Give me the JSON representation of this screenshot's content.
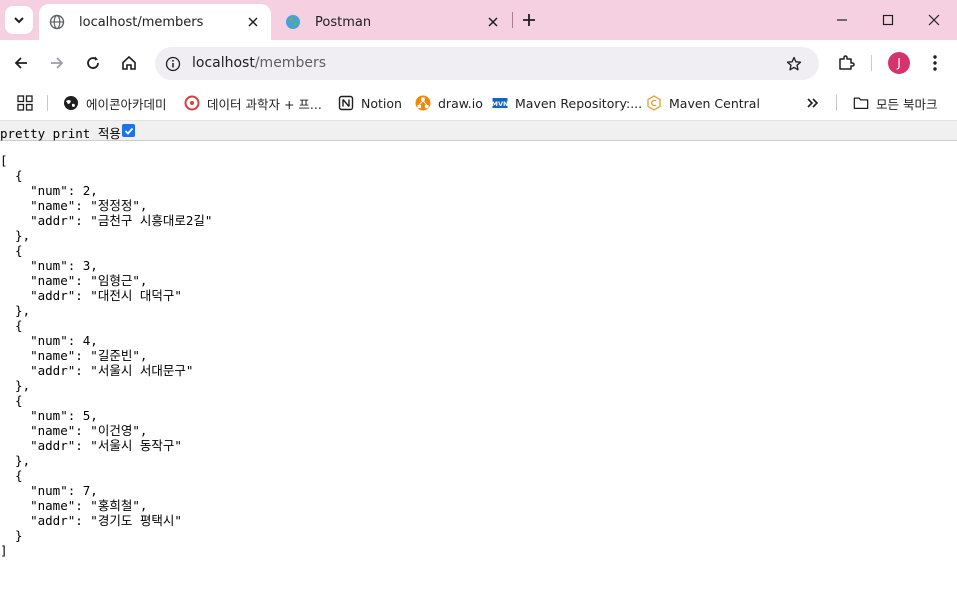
{
  "browser": {
    "tabs": [
      {
        "title": "localhost/members",
        "active": true,
        "favicon": "globe-icon"
      },
      {
        "title": "Postman",
        "active": false,
        "favicon": "earth-icon"
      }
    ],
    "address": {
      "host": "localhost",
      "path": "/members"
    },
    "profile_initial": "J"
  },
  "bookmarks": {
    "items": [
      {
        "label": "에이콘아카데미",
        "icon": "globe-icon"
      },
      {
        "label": "데이터 과학자 + 프...",
        "icon": "red-circle-icon"
      },
      {
        "label": "Notion",
        "icon": "notion-icon"
      },
      {
        "label": "draw.io",
        "icon": "drawio-icon"
      },
      {
        "label": "Maven Repository:...",
        "icon": "mvn-icon"
      },
      {
        "label": "Maven Central",
        "icon": "maven-central-icon"
      }
    ],
    "all_bookmarks_label": "모든 북마크"
  },
  "json_viewer": {
    "pretty_print_label": "pretty print 적용",
    "pretty_print_checked": true,
    "content": "[\n  {\n    \"num\": 2,\n    \"name\": \"정정정\",\n    \"addr\": \"금천구 시흥대로2길\"\n  },\n  {\n    \"num\": 3,\n    \"name\": \"임형근\",\n    \"addr\": \"대전시 대덕구\"\n  },\n  {\n    \"num\": 4,\n    \"name\": \"길준빈\",\n    \"addr\": \"서울시 서대문구\"\n  },\n  {\n    \"num\": 5,\n    \"name\": \"이건영\",\n    \"addr\": \"서울시 동작구\"\n  },\n  {\n    \"num\": 7,\n    \"name\": \"홍희철\",\n    \"addr\": \"경기도 평택시\"\n  }\n]"
  }
}
